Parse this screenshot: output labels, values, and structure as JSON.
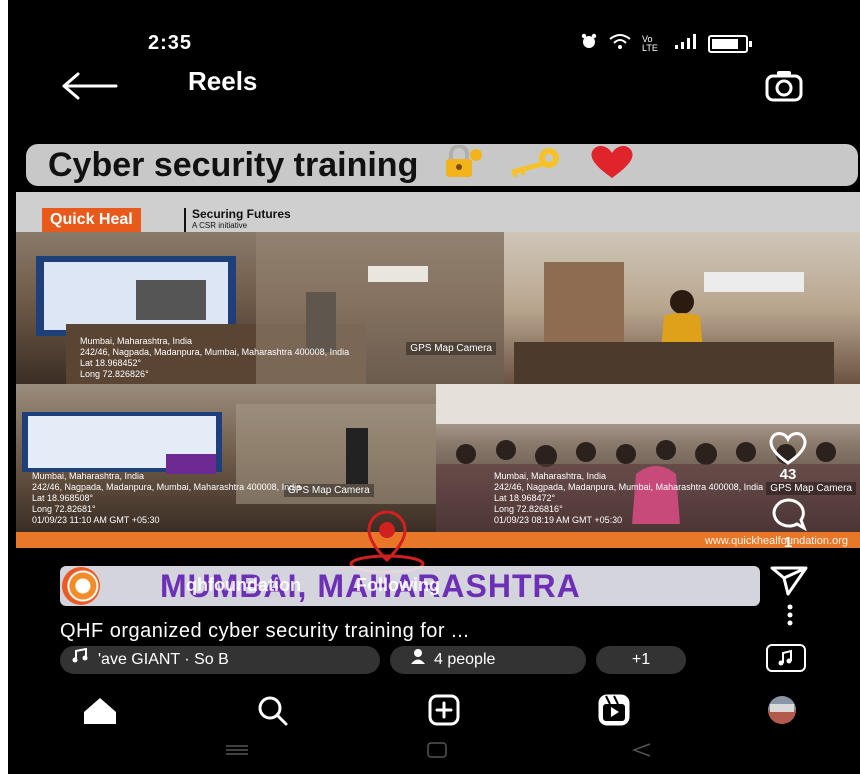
{
  "status_bar": {
    "time": "2:35",
    "network": "Vo LTE"
  },
  "header": {
    "title": "Reels"
  },
  "banner": {
    "text": "Cyber security training"
  },
  "reel": {
    "brand": "Quick Heal",
    "tagline": "Securing Futures",
    "tagline_sub": "A CSR initiative",
    "photos": [
      {
        "gps_label": "GPS Map Camera",
        "lines": [
          "Mumbai, Maharashtra, India",
          "242/46, Nagpada, Madanpura, Mumbai, Maharashtra 400008, India",
          "Lat 18.968452°",
          "Long 72.826826°"
        ]
      },
      {
        "gps_label": "GPS Map Camera",
        "lines": [
          "Mumbai, Maharashtra, India",
          "242/46, Nagpada, Madanpura, Mumbai, Maharashtra 400008, India",
          "Lat 18.968508°",
          "Long 72.82681°",
          "01/09/23 11:10 AM GMT +05:30"
        ]
      },
      {
        "gps_label": "GPS Map Camera",
        "lines": [
          "Mumbai, Maharashtra, India",
          "242/46, Nagpada, Madanpura, Mumbai, Maharashtra 400008, India",
          "Lat 18.968472°",
          "Long 72.826816°",
          "01/09/23 08:19 AM GMT +05:30"
        ]
      }
    ],
    "footer_url": "www.quickhealfoundation.org",
    "location_overlay": "MUMBAI, MAHARASHTRA",
    "author": "qhfoundation",
    "follow_label": "Following",
    "caption": "QHF organized cyber security training for ...",
    "music": "'ave GIANT · So B",
    "people": "4 people",
    "more_tags": "+1"
  },
  "actions": {
    "likes": "43",
    "comments": "1"
  },
  "colors": {
    "brand_orange": "#e85a1b",
    "location_purple": "#6c2fb5",
    "chip_bg": "#333333"
  }
}
